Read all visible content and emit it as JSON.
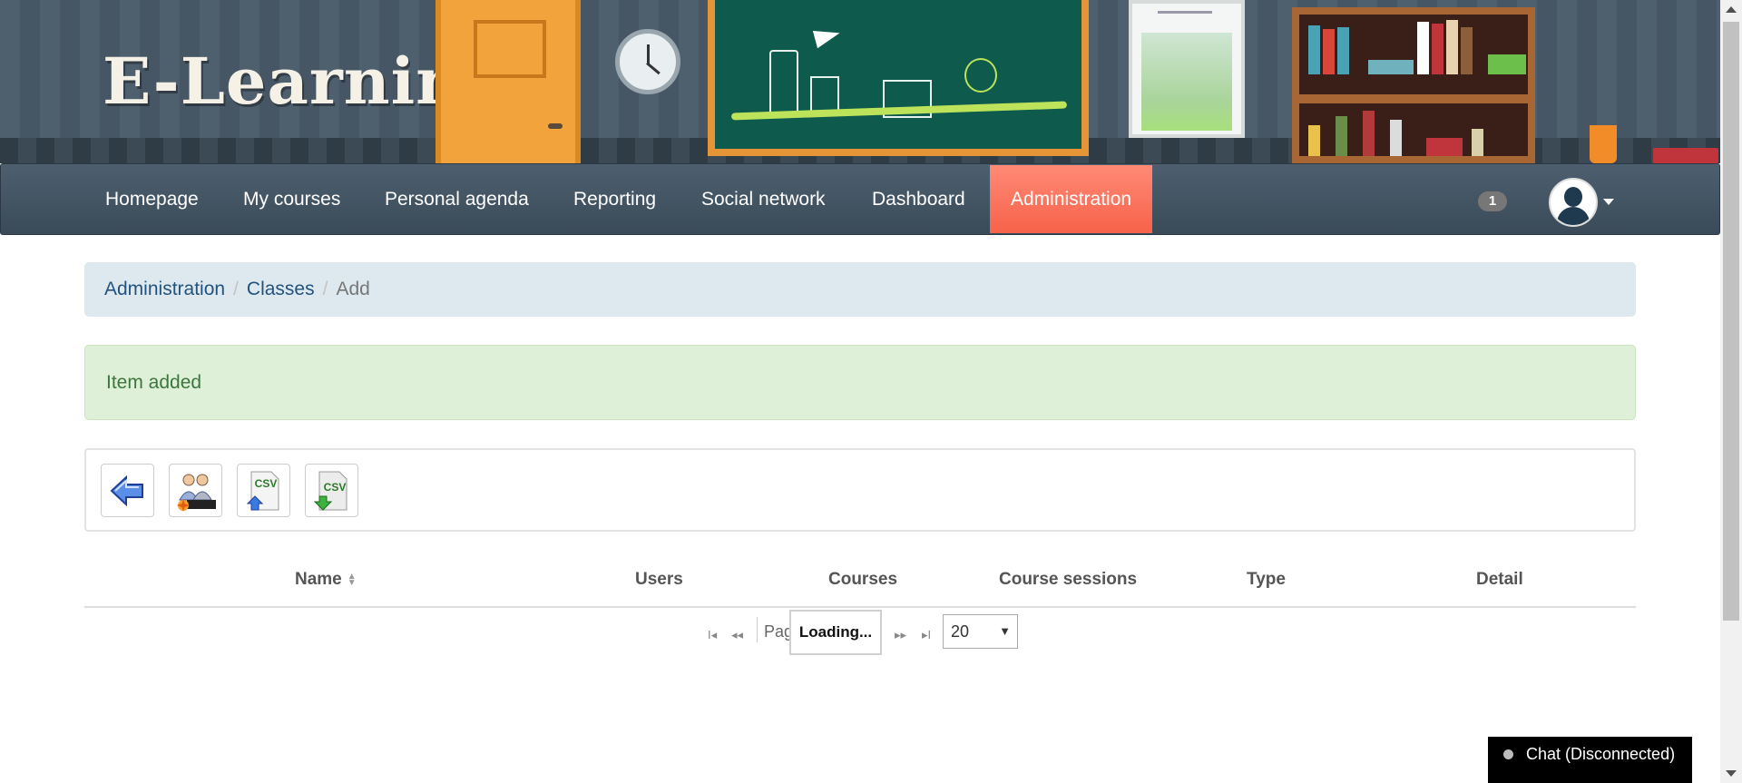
{
  "header": {
    "logo_text": "E-Learning"
  },
  "nav": {
    "items": [
      {
        "label": "Homepage"
      },
      {
        "label": "My courses"
      },
      {
        "label": "Personal agenda"
      },
      {
        "label": "Reporting"
      },
      {
        "label": "Social network"
      },
      {
        "label": "Dashboard"
      },
      {
        "label": "Administration",
        "active": true
      }
    ],
    "notification_count": "1",
    "active_color": "#f7624a"
  },
  "breadcrumb": {
    "items": [
      {
        "label": "Administration"
      },
      {
        "label": "Classes"
      }
    ],
    "current": "Add"
  },
  "alert": {
    "message": "Item added",
    "type": "success"
  },
  "toolbar": {
    "buttons": [
      {
        "icon": "back-arrow-icon"
      },
      {
        "icon": "add-class-icon"
      },
      {
        "icon": "csv-import-icon",
        "text": "CSV"
      },
      {
        "icon": "csv-export-icon",
        "text": "CSV"
      }
    ]
  },
  "table": {
    "columns": [
      "Name",
      "Users",
      "Courses",
      "Course sessions",
      "Type",
      "Detail"
    ]
  },
  "pager": {
    "page_label": "Pag",
    "status": "Loading...",
    "rows_per_page": "20"
  },
  "chat": {
    "label": "Chat (Disconnected)"
  }
}
